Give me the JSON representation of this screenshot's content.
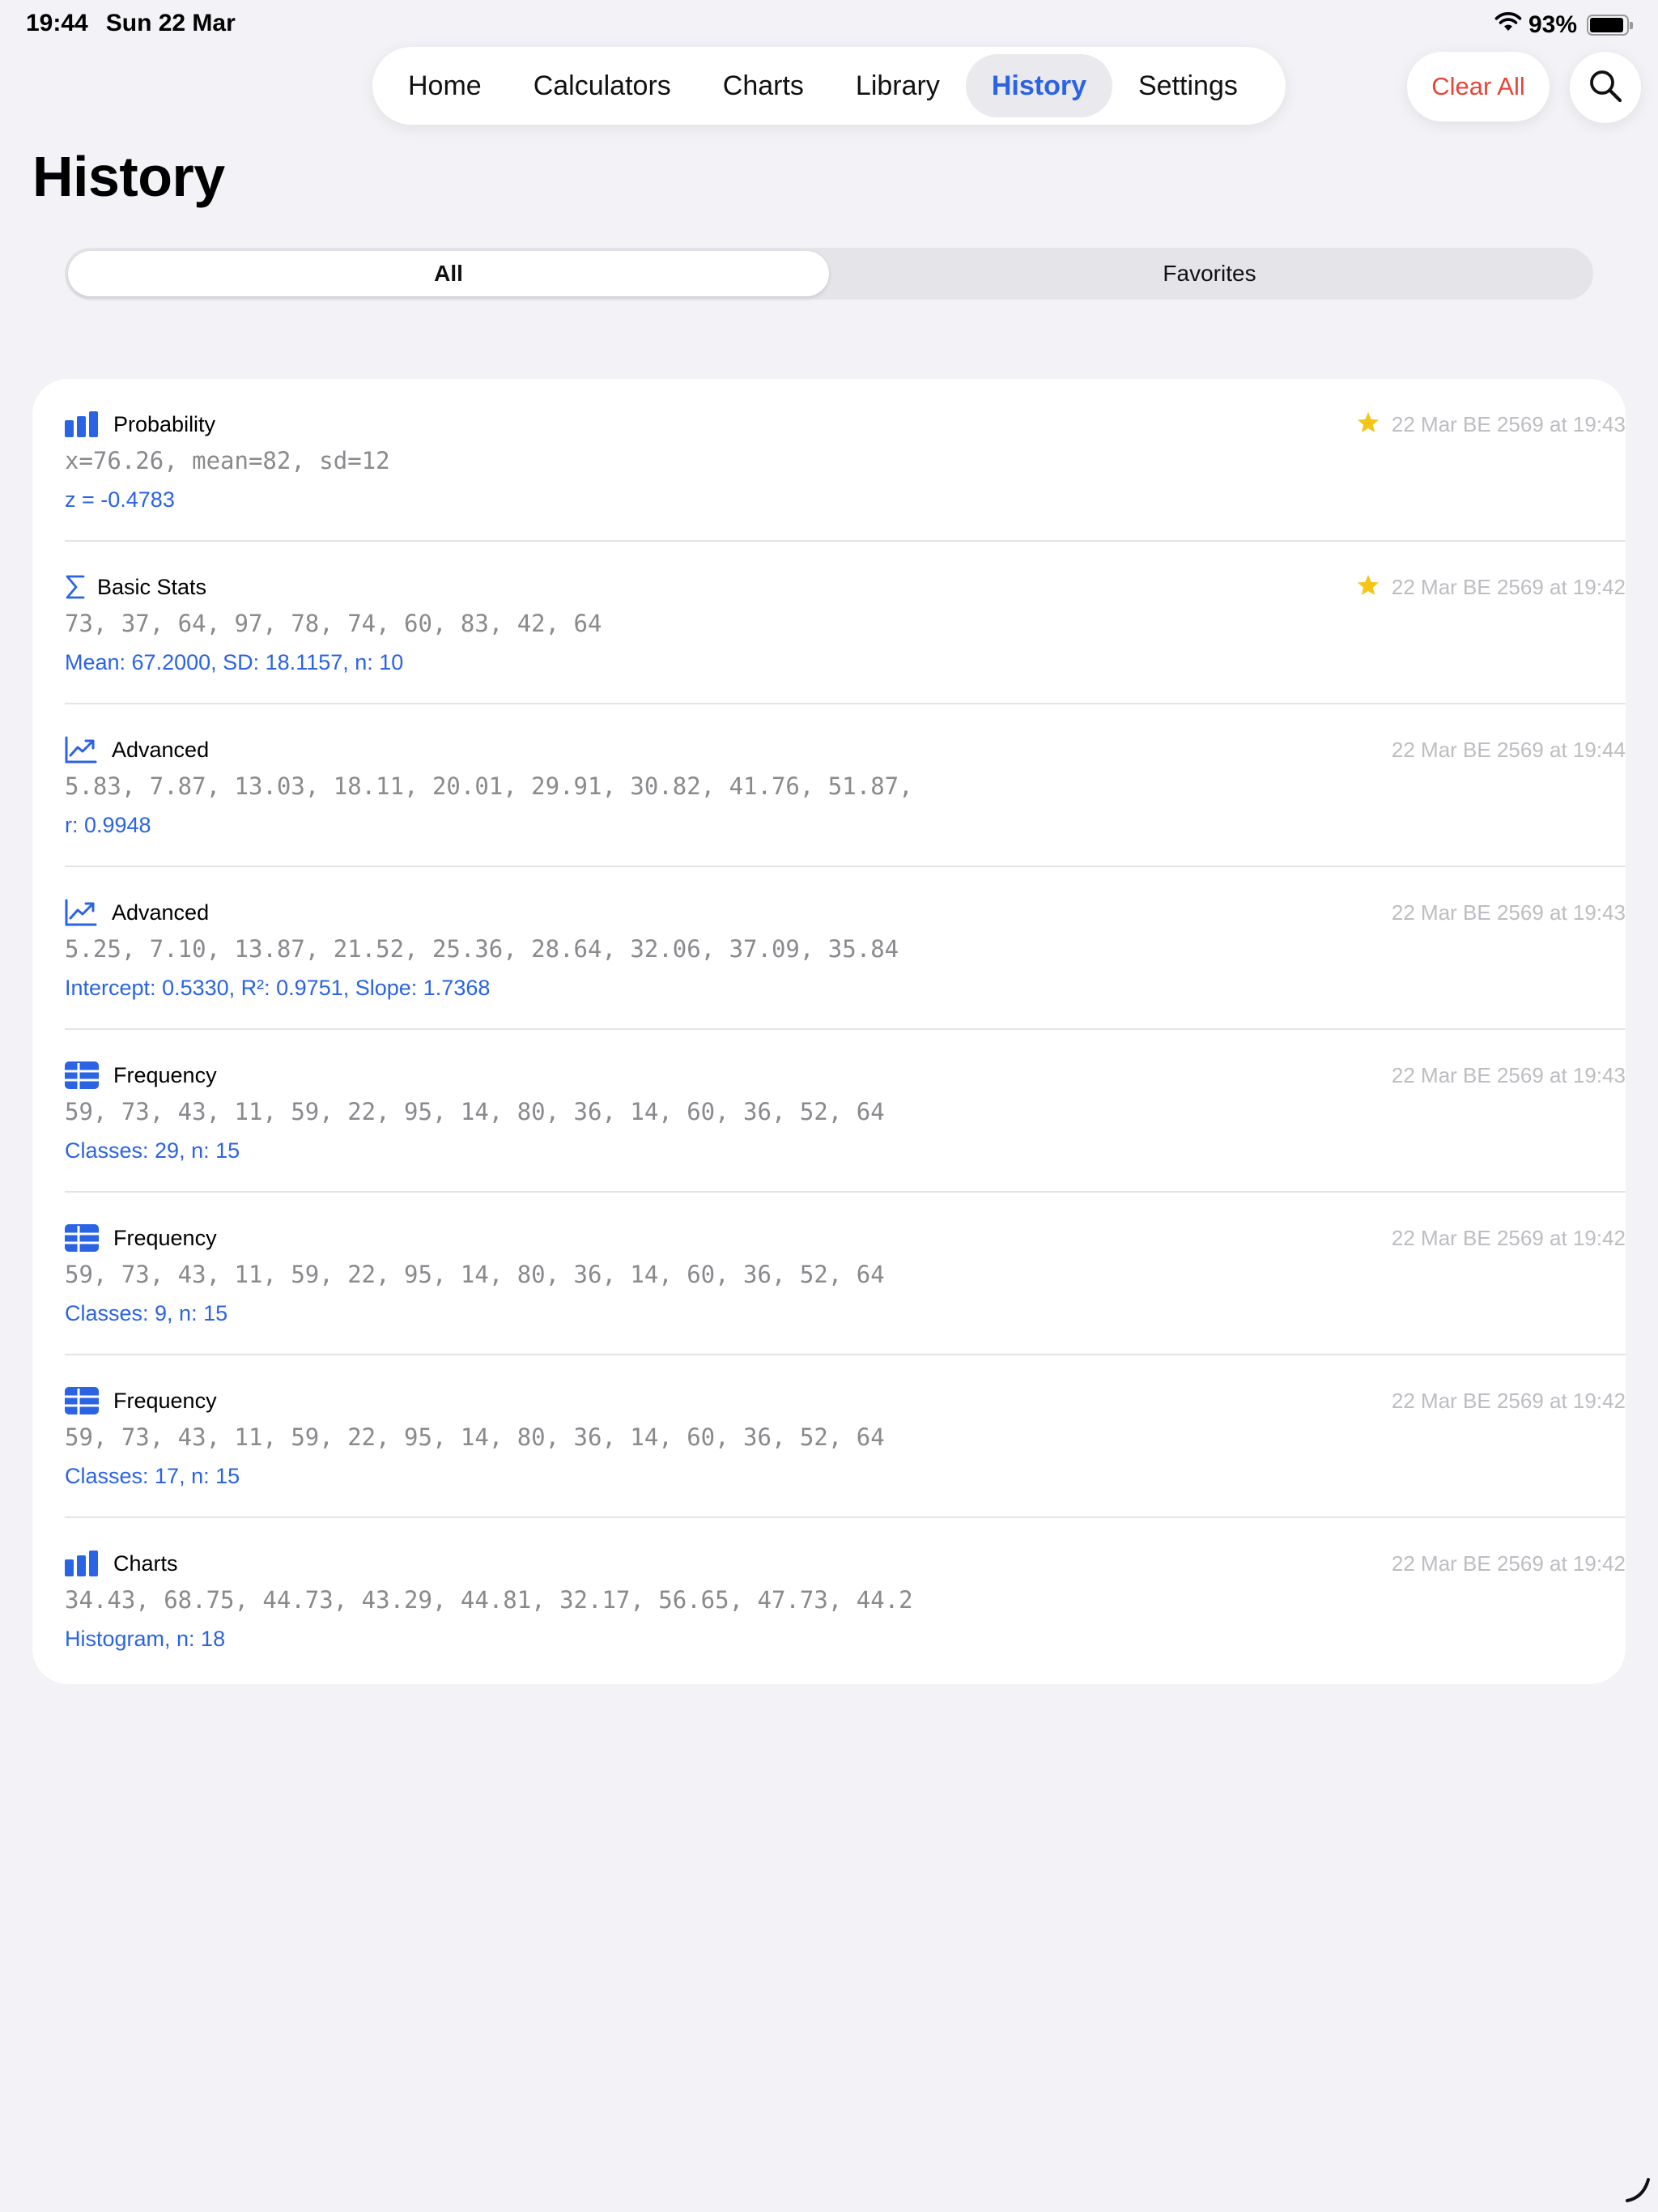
{
  "status_bar": {
    "time": "19:44",
    "date": "Sun 22 Mar",
    "battery": "93%",
    "battery_level": 0.93
  },
  "nav": {
    "tabs": [
      {
        "label": "Home"
      },
      {
        "label": "Calculators"
      },
      {
        "label": "Charts"
      },
      {
        "label": "Library"
      },
      {
        "label": "History",
        "active": true
      },
      {
        "label": "Settings"
      }
    ],
    "clear_label": "Clear All"
  },
  "page": {
    "title": "History"
  },
  "filter": {
    "options": [
      "All",
      "Favorites"
    ],
    "selected": "All"
  },
  "history": [
    {
      "icon": "bar-chart-icon",
      "title": "Probability",
      "favorite": true,
      "date": "22 Mar BE 2569 at 19:43",
      "input": "x=76.26, mean=82, sd=12",
      "result": "z = -0.4783"
    },
    {
      "icon": "sigma-icon",
      "title": "Basic Stats",
      "favorite": true,
      "date": "22 Mar BE 2569 at 19:42",
      "input": "73, 37, 64, 97, 78, 74, 60, 83, 42, 64",
      "result": "Mean: 67.2000, SD: 18.1157, n: 10"
    },
    {
      "icon": "trend-chart-icon",
      "title": "Advanced",
      "favorite": false,
      "date": "22 Mar BE 2569 at 19:44",
      "input": "5.83, 7.87, 13.03, 18.11, 20.01, 29.91, 30.82, 41.76, 51.87,",
      "result": "r: 0.9948"
    },
    {
      "icon": "trend-chart-icon",
      "title": "Advanced",
      "favorite": false,
      "date": "22 Mar BE 2569 at 19:43",
      "input": "5.25, 7.10, 13.87, 21.52, 25.36, 28.64, 32.06, 37.09, 35.84",
      "result": "Intercept: 0.5330, R²: 0.9751, Slope: 1.7368"
    },
    {
      "icon": "table-icon",
      "title": "Frequency",
      "favorite": false,
      "date": "22 Mar BE 2569 at 19:43",
      "input": "59, 73, 43, 11, 59, 22, 95, 14, 80, 36, 14, 60, 36, 52, 64",
      "result": "Classes: 29, n: 15"
    },
    {
      "icon": "table-icon",
      "title": "Frequency",
      "favorite": false,
      "date": "22 Mar BE 2569 at 19:42",
      "input": "59, 73, 43, 11, 59, 22, 95, 14, 80, 36, 14, 60, 36, 52, 64",
      "result": "Classes: 9, n: 15"
    },
    {
      "icon": "table-icon",
      "title": "Frequency",
      "favorite": false,
      "date": "22 Mar BE 2569 at 19:42",
      "input": "59, 73, 43, 11, 59, 22, 95, 14, 80, 36, 14, 60, 36, 52, 64",
      "result": "Classes: 17, n: 15"
    },
    {
      "icon": "bar-chart-icon",
      "title": "Charts",
      "favorite": false,
      "date": "22 Mar BE 2569 at 19:42",
      "input": "34.43, 68.75, 44.73, 43.29, 44.81, 32.17, 56.65, 47.73, 44.2",
      "result": "Histogram, n: 18"
    }
  ],
  "colors": {
    "accent": "#2A63E4",
    "destructive": "#E5463A",
    "favorite_star": "#F5C518",
    "background": "#F2F2F7"
  }
}
